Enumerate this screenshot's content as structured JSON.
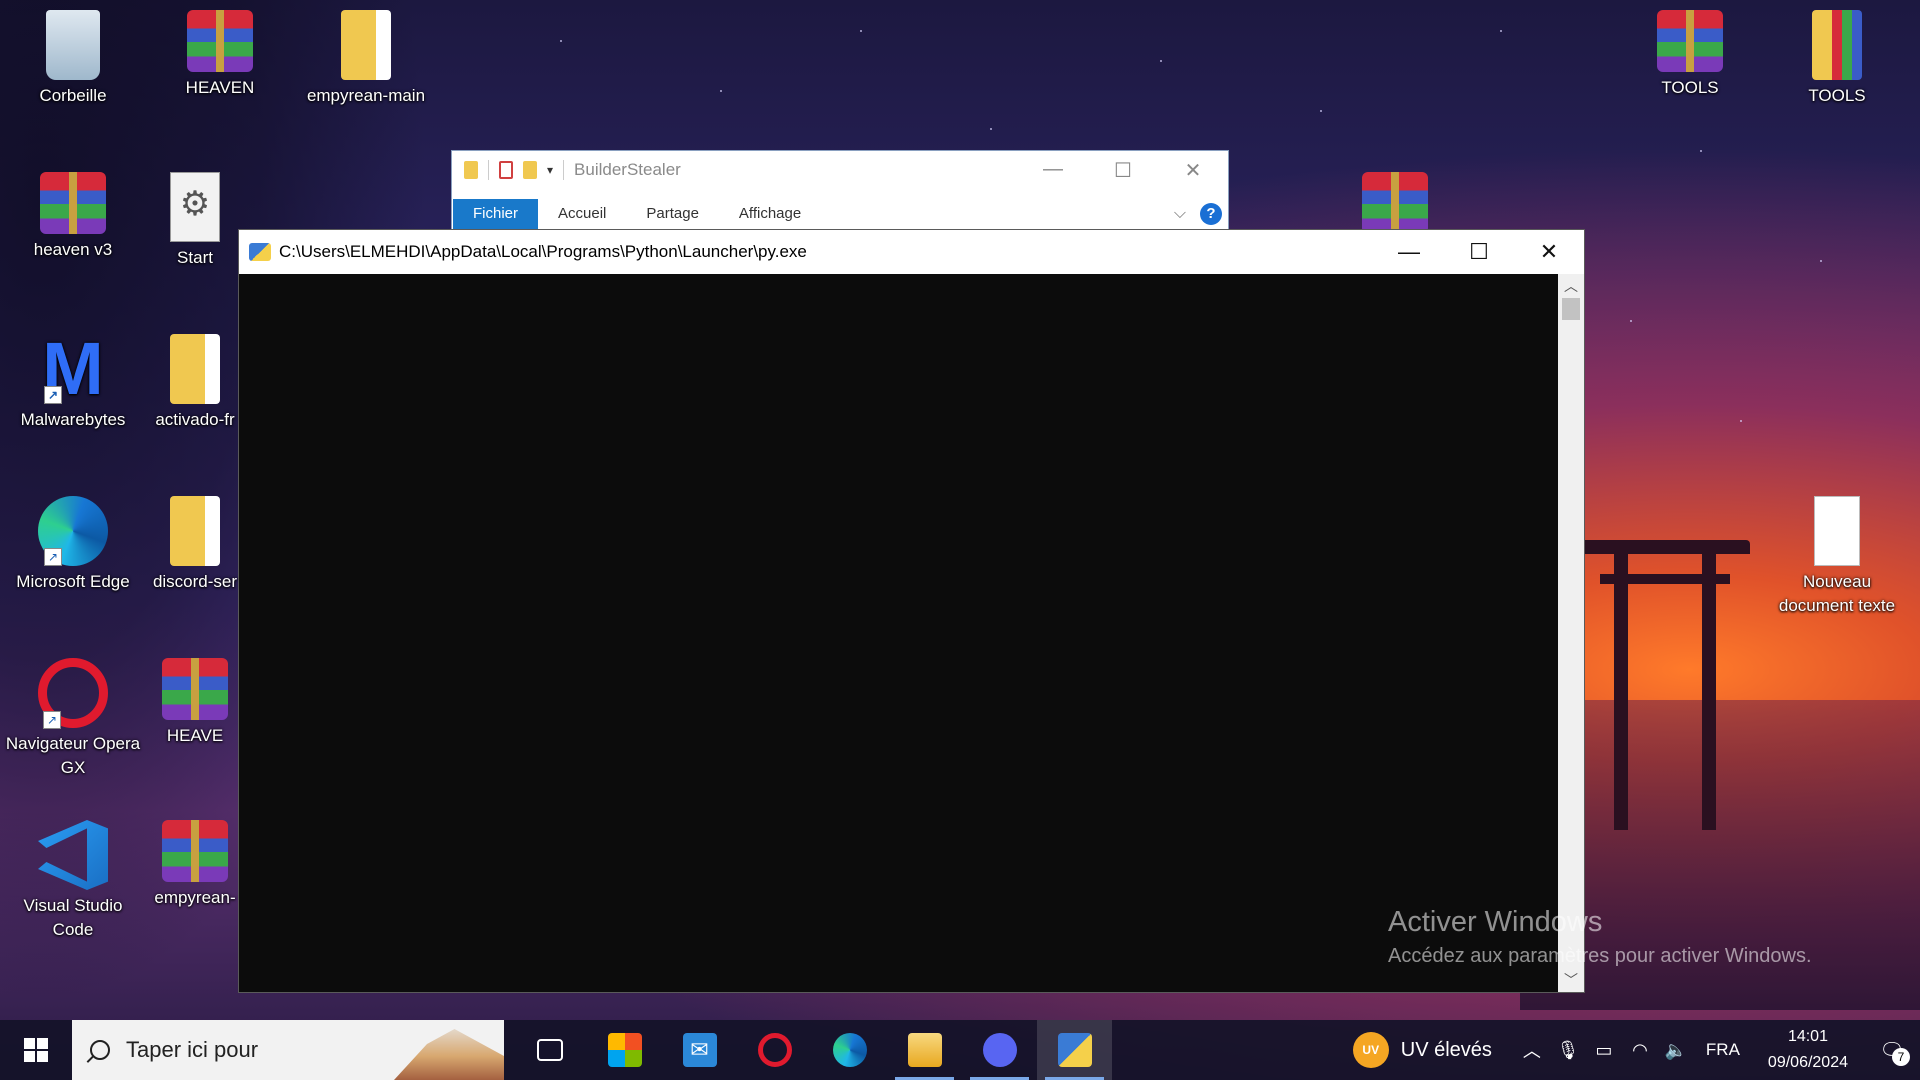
{
  "desktop": {
    "icons": [
      {
        "label": "Corbeille",
        "icon": "recycle-bin-icon"
      },
      {
        "label": "HEAVEN",
        "icon": "winrar-archive-icon"
      },
      {
        "label": "empyrean-main",
        "icon": "folder-icon"
      },
      {
        "label": "heaven v3",
        "icon": "winrar-archive-icon"
      },
      {
        "label": "Start",
        "icon": "settings-file-icon"
      },
      {
        "label": "Malwarebytes",
        "icon": "malwarebytes-icon"
      },
      {
        "label": "activado-fr",
        "icon": "folder-icon"
      },
      {
        "label": "Microsoft Edge",
        "icon": "edge-icon"
      },
      {
        "label": "discord-ser",
        "icon": "folder-icon"
      },
      {
        "label": "Navigateur Opera GX",
        "icon": "opera-gx-icon"
      },
      {
        "label": "HEAVE",
        "icon": "winrar-archive-icon"
      },
      {
        "label": "Visual Studio Code",
        "icon": "vscode-icon"
      },
      {
        "label": "empyrean-",
        "icon": "winrar-archive-icon"
      },
      {
        "label": "TOOLS",
        "icon": "winrar-archive-icon"
      },
      {
        "label": "TOOLS",
        "icon": "folder-icon"
      },
      {
        "label": "Nouveau document texte",
        "icon": "text-document-icon"
      }
    ]
  },
  "explorer": {
    "title": "BuilderStealer",
    "tabs": [
      "Fichier",
      "Accueil",
      "Partage",
      "Affichage"
    ],
    "help": "?"
  },
  "console": {
    "title": "C:\\Users\\ELMEHDI\\AppData\\Local\\Programs\\Python\\Launcher\\py.exe"
  },
  "watermark": {
    "line1": "Activer Windows",
    "line2": "Accédez aux paramètres pour activer Windows."
  },
  "taskbar": {
    "search_placeholder": "Taper ici pour",
    "apps": [
      {
        "name": "task-view",
        "icon": "task-view-icon"
      },
      {
        "name": "microsoft-store",
        "icon": "store-icon"
      },
      {
        "name": "mail",
        "icon": "mail-icon"
      },
      {
        "name": "opera",
        "icon": "opera-icon"
      },
      {
        "name": "edge",
        "icon": "edge-icon"
      },
      {
        "name": "file-explorer",
        "icon": "folder-icon"
      },
      {
        "name": "discord",
        "icon": "discord-icon"
      },
      {
        "name": "python-launcher",
        "icon": "python-icon"
      }
    ],
    "weather_badge": "UV",
    "weather_label": "UV élevés",
    "language": "FRA",
    "time": "14:01",
    "date": "09/06/2024",
    "notification_count": "7"
  }
}
